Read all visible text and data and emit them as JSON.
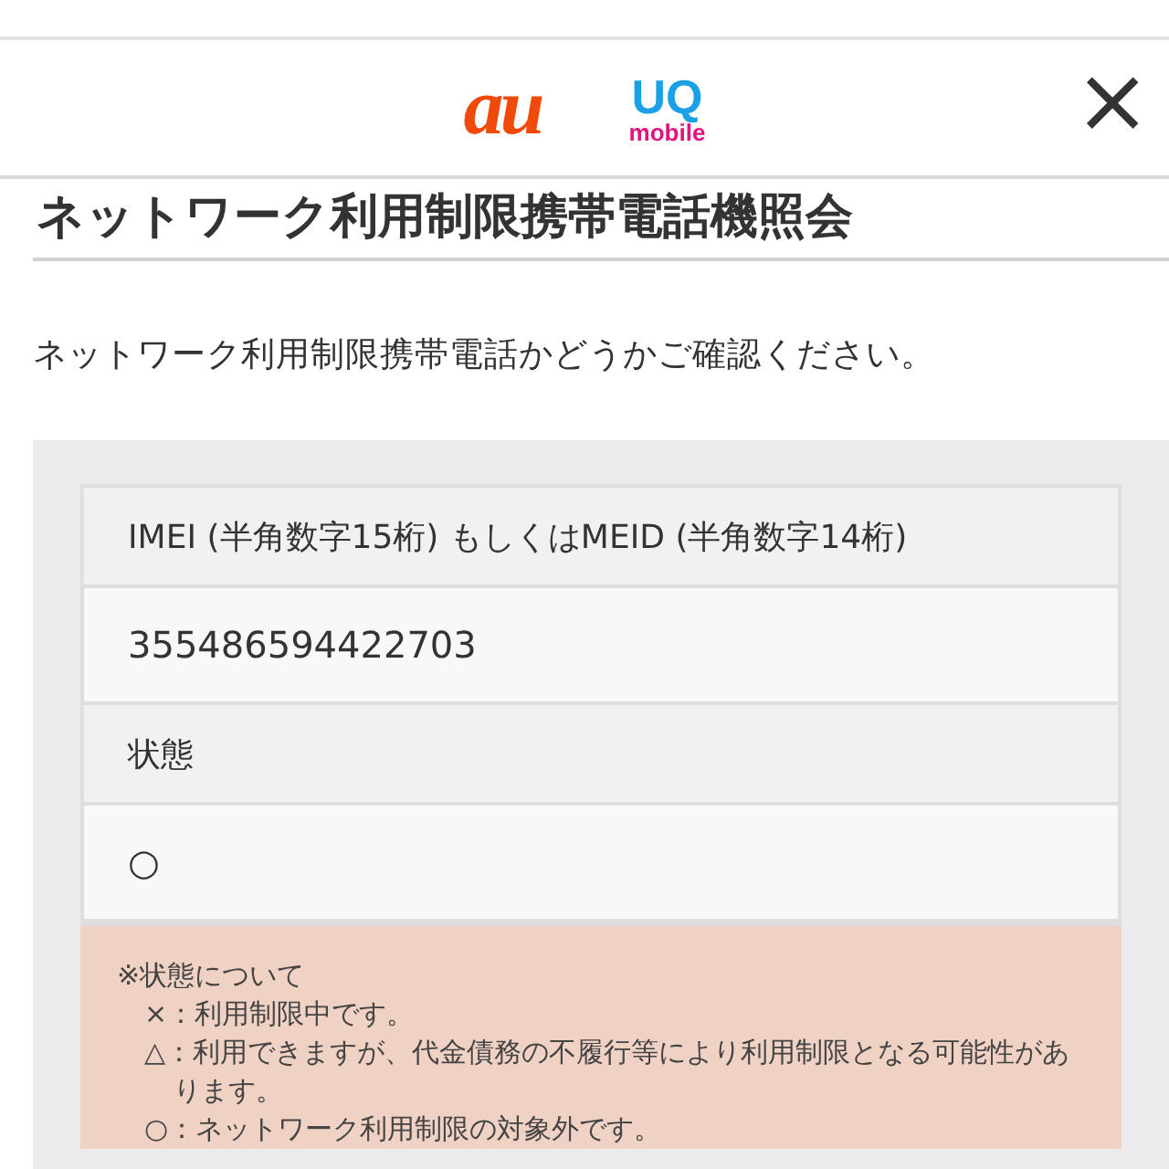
{
  "header": {
    "logo_au": "au",
    "logo_uq": "UQ",
    "logo_uq_sub": "mobile",
    "close": "×"
  },
  "title": "ネットワーク利用制限携帯電話機照会",
  "intro": "ネットワーク利用制限携帯電話かどうかご確認ください。",
  "result_table": [
    {
      "kind": "label",
      "text": "IMEI (半角数字15桁) もしくはMEID (半角数字14桁)"
    },
    {
      "kind": "value",
      "text": "355486594422703"
    },
    {
      "kind": "label",
      "text": "状態"
    },
    {
      "kind": "value",
      "text": "○"
    }
  ],
  "note": {
    "heading": "※状態について",
    "items": [
      "×：利用制限中です。",
      "△：利用できますが、代金債務の不履行等により利用制限となる可能性があります。",
      "○：ネットワーク利用制限の対象外です。"
    ]
  }
}
